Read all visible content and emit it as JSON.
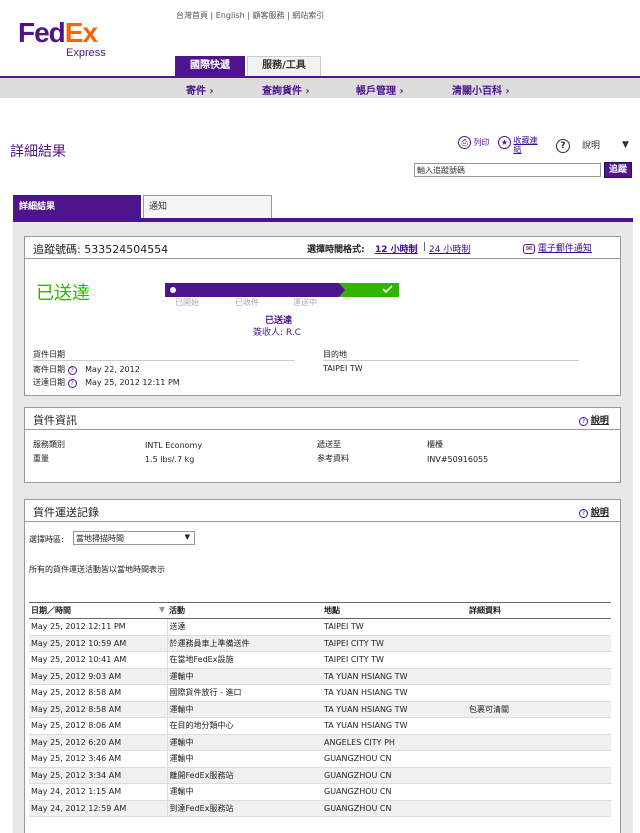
{
  "header": {
    "logo_fed": "Fed",
    "logo_ex": "Ex",
    "logo_sub": "Express",
    "toplinks": "台灣首頁 | English | 顧客服務 | 網站索引",
    "tabs": [
      "國際快遞",
      "服務/工具"
    ],
    "nav": [
      "寄件 ›",
      "查詢貨件 ›",
      "帳戶管理 ›",
      "清關小百科 ›"
    ]
  },
  "page": {
    "title": "詳細結果",
    "print": "列印",
    "favorite": "收藏連結",
    "help": "說明",
    "track_placeholder": "輸入追蹤號碼",
    "track_button": "追蹤"
  },
  "content_tabs": [
    "詳細結果",
    "通知"
  ],
  "summary": {
    "tracking_label": "追蹤號碼: 533524504554",
    "time_format_label": "選擇時間格式:",
    "time_12": "12 小時制",
    "time_sep": "|",
    "time_24": "24 小時制",
    "email_notify": "電子郵件通知",
    "status": "已送達",
    "progress": [
      "已開始",
      "已收件",
      "運送中",
      "已送達"
    ],
    "progress_current_step": 4,
    "delivered_label": "已送達",
    "signed_by": "簽收人: R.C",
    "shipment_dates_label": "貨件日期",
    "destination_label": "目的地",
    "ship_date_label": "寄件日期",
    "ship_date": "May 22, 2012",
    "delivery_date_label": "送達日期",
    "delivery_date": "May 25, 2012 12:11 PM",
    "destination": "TAIPEI TW"
  },
  "shipment_info": {
    "title": "貨件資訊",
    "help": "說明",
    "service_label": "服務類別",
    "service_value": "INTL Economy",
    "weight_label": "重量",
    "weight_value": "1.5 lbs/.7 kg",
    "delivered_to_label": "遞送至",
    "delivered_to_value": "櫃檯",
    "reference_label": "参考資料",
    "reference_value": "INV#50916055"
  },
  "travel_history": {
    "title": "貨件運送記錄",
    "help": "說明",
    "timezone_label": "選擇時區:",
    "timezone_value": "當地掃描時間",
    "note": "所有的貨件運送活動皆以當地時間表示",
    "columns": [
      "日期／時間",
      "活動",
      "地點",
      "詳細資料"
    ],
    "rows": [
      [
        "May 25, 2012 12:11 PM",
        "送達",
        "TAIPEI TW",
        ""
      ],
      [
        "May 25, 2012 10:59 AM",
        "於運務員車上準備送件",
        "TAIPEI CITY TW",
        ""
      ],
      [
        "May 25, 2012 10:41 AM",
        "在當地FedEx設施",
        "TAIPEI CITY TW",
        ""
      ],
      [
        "May 25, 2012 9:03 AM",
        "運輸中",
        "TA YUAN HSIANG TW",
        ""
      ],
      [
        "May 25, 2012 8:58 AM",
        "國際貨件放行 - 進口",
        "TA YUAN HSIANG TW",
        ""
      ],
      [
        "May 25, 2012 8:58 AM",
        "運輸中",
        "TA YUAN HSIANG TW",
        "包裹可清關"
      ],
      [
        "May 25, 2012 8:06 AM",
        "在目的地分類中心",
        "TA YUAN HSIANG TW",
        ""
      ],
      [
        "May 25, 2012 6:20 AM",
        "運輸中",
        "ANGELES CITY PH",
        ""
      ],
      [
        "May 25, 2012 3:46 AM",
        "運輸中",
        "GUANGZHOU CN",
        ""
      ],
      [
        "May 25, 2012 3:34 AM",
        "離開FedEx服務站",
        "GUANGZHOU CN",
        ""
      ],
      [
        "May 24, 2012 1:15 AM",
        "運輸中",
        "GUANGZHOU CN",
        ""
      ],
      [
        "May 24, 2012 12:59 AM",
        "到達FedEx服務站",
        "GUANGZHOU CN",
        ""
      ]
    ]
  },
  "colors": {
    "brand_purple": "#4d148c",
    "brand_orange": "#ff6200",
    "delivered_green": "#33b400"
  }
}
